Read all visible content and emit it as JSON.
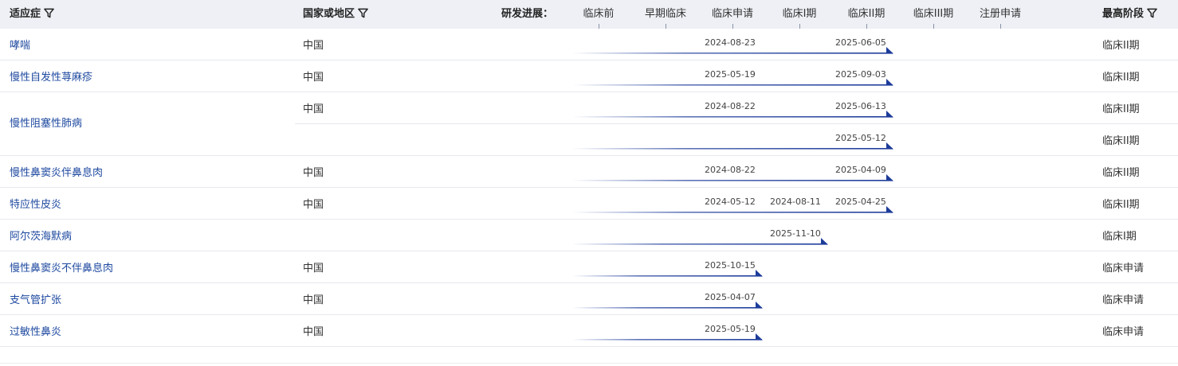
{
  "header": {
    "indication": "适应症",
    "region": "国家或地区",
    "progress_label": "研发进展：",
    "highest_stage": "最高阶段",
    "stages": [
      "临床前",
      "早期临床",
      "临床申请",
      "临床I期",
      "临床II期",
      "临床III期",
      "注册申请"
    ]
  },
  "colors": {
    "bar": "#1c3b9a",
    "link": "#1f4aa0",
    "header_bg": "#eef0f5"
  },
  "icons": {
    "filter": "filter-icon"
  },
  "rows": [
    {
      "indication": "哮喘",
      "region": "中国",
      "dates": [
        "2024-08-23",
        "2025-06-05"
      ],
      "highest": "临床II期"
    },
    {
      "indication": "慢性自发性荨麻疹",
      "region": "中国",
      "dates": [
        "2025-05-19",
        "2025-09-03"
      ],
      "highest": "临床II期"
    },
    {
      "indication": "慢性阻塞性肺病",
      "sub": [
        {
          "region": "中国",
          "dates": [
            "2024-08-22",
            "2025-06-13"
          ],
          "highest": "临床II期"
        },
        {
          "region": "",
          "dates": [
            "2025-05-12"
          ],
          "highest": "临床II期"
        }
      ]
    },
    {
      "indication": "慢性鼻窦炎伴鼻息肉",
      "region": "中国",
      "dates": [
        "2024-08-22",
        "2025-04-09"
      ],
      "highest": "临床II期"
    },
    {
      "indication": "特应性皮炎",
      "region": "中国",
      "dates": [
        "2024-05-12",
        "2024-08-11",
        "2025-04-25"
      ],
      "highest": "临床II期"
    },
    {
      "indication": "阿尔茨海默病",
      "region": "",
      "dates": [
        "2025-11-10"
      ],
      "highest": "临床I期"
    },
    {
      "indication": "慢性鼻窦炎不伴鼻息肉",
      "region": "中国",
      "dates": [
        "2025-10-15"
      ],
      "highest": "临床申请"
    },
    {
      "indication": "支气管扩张",
      "region": "中国",
      "dates": [
        "2025-04-07"
      ],
      "highest": "临床申请"
    },
    {
      "indication": "过敏性鼻炎",
      "region": "中国",
      "dates": [
        "2025-05-19"
      ],
      "highest": "临床申请"
    }
  ]
}
